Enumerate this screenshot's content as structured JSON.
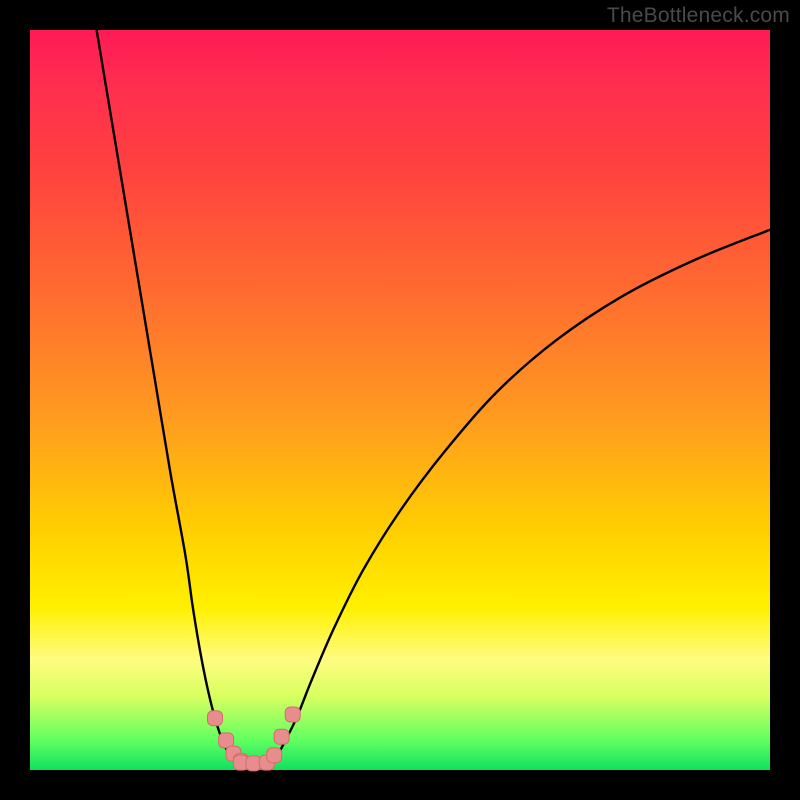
{
  "watermark": "TheBottleneck.com",
  "colors": {
    "frame": "#000000",
    "curve": "#000000",
    "marker_fill": "#e88d8d",
    "marker_stroke": "#d86b6b",
    "gradient_top": "#ff1a55",
    "gradient_bottom": "#10e060"
  },
  "chart_data": {
    "type": "line",
    "title": "",
    "xlabel": "",
    "ylabel": "",
    "xlim": [
      0,
      100
    ],
    "ylim": [
      0,
      100
    ],
    "grid": false,
    "note": "No axis ticks/labels visible; values estimated from pixel positions as percentages of plot area. y=0 at bottom (green), y=100 at top (red).",
    "series": [
      {
        "name": "curve-left",
        "x": [
          9,
          11,
          13,
          15,
          17,
          19,
          21,
          22,
          23,
          24,
          25,
          26,
          27,
          28
        ],
        "y": [
          100,
          88,
          76,
          64,
          52,
          40,
          29,
          22,
          16,
          11,
          7,
          4,
          2,
          1
        ]
      },
      {
        "name": "curve-right",
        "x": [
          33,
          34,
          36,
          38,
          41,
          45,
          50,
          56,
          63,
          71,
          80,
          90,
          100
        ],
        "y": [
          1,
          3,
          7,
          12,
          19,
          27,
          35,
          43,
          51,
          58,
          64,
          69,
          73
        ]
      },
      {
        "name": "markers-left",
        "type": "scatter",
        "x": [
          25.0,
          26.5,
          27.5,
          28.5
        ],
        "y": [
          7.0,
          4.0,
          2.2,
          1.2
        ]
      },
      {
        "name": "markers-bottom",
        "type": "scatter",
        "x": [
          28.5,
          30.2,
          32.0
        ],
        "y": [
          1.0,
          0.9,
          1.0
        ]
      },
      {
        "name": "markers-right",
        "type": "scatter",
        "x": [
          33.0,
          34.0,
          35.5
        ],
        "y": [
          2.0,
          4.5,
          7.5
        ]
      }
    ]
  }
}
